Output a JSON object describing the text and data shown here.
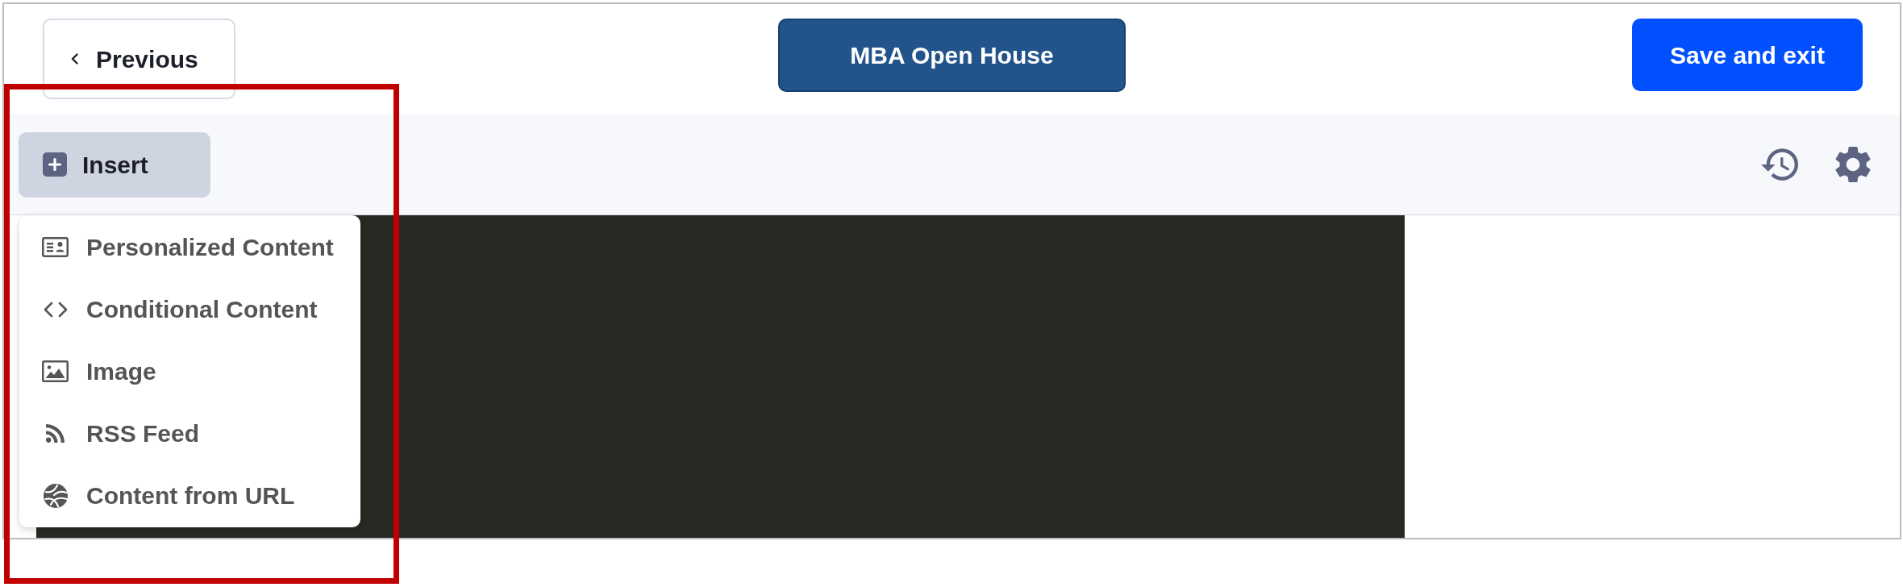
{
  "header": {
    "previous_button": {
      "label": "Previous"
    },
    "title_button": {
      "label": "MBA Open House"
    },
    "save_button": {
      "label": "Save and exit"
    }
  },
  "toolbar": {
    "insert_button": {
      "label": "Insert",
      "expanded": true
    },
    "insert_menu": {
      "items": [
        {
          "label": "Personalized Content"
        },
        {
          "label": "Conditional Content"
        },
        {
          "label": "Image"
        },
        {
          "label": "RSS Feed"
        },
        {
          "label": "Content from URL"
        }
      ]
    }
  }
}
